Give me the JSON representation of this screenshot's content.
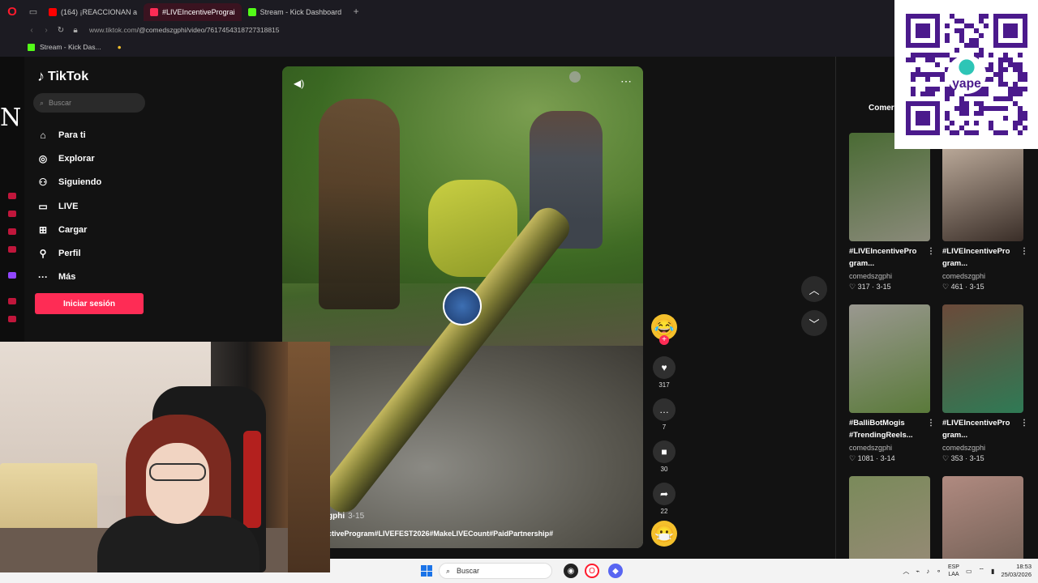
{
  "browser": {
    "tabs": [
      {
        "label": "(164) ¡REACCIONAN a",
        "color": "#ff0000"
      },
      {
        "label": "#LIVEIncentivePrograi",
        "color": "#fe2c55",
        "active": true
      },
      {
        "label": "Stream - Kick Dashboard",
        "color": "#53fc18"
      }
    ],
    "url_host": "www.tiktok.com",
    "url_path": "/@comedszgphi/video/7617454318727318815",
    "bookmark": "Stream - Kick Das..."
  },
  "tiktok": {
    "logo": "TikTok",
    "search_placeholder": "Buscar",
    "nav": [
      {
        "label": "Para ti",
        "icon": "home-icon",
        "glyph": "⌂"
      },
      {
        "label": "Explorar",
        "icon": "compass-icon",
        "glyph": "◎"
      },
      {
        "label": "Siguiendo",
        "icon": "following-icon",
        "glyph": "⚇"
      },
      {
        "label": "LIVE",
        "icon": "live-icon",
        "glyph": "▭"
      },
      {
        "label": "Cargar",
        "icon": "upload-icon",
        "glyph": "⊞"
      },
      {
        "label": "Perfil",
        "icon": "profile-icon",
        "glyph": "⚲"
      },
      {
        "label": "Más",
        "icon": "more-icon",
        "glyph": "···"
      }
    ],
    "login_button": "Iniciar sesión",
    "side_letter": "N"
  },
  "video": {
    "author": "gphi",
    "date": "3-15",
    "hashtags": "ctiveProgram#LIVEFEST2026#MakeLIVECount#PaidPartnership#"
  },
  "actions": {
    "likes": "317",
    "comments": "7",
    "saves": "30",
    "shares": "22"
  },
  "right_panel": {
    "tab": "Comer",
    "cards": [
      {
        "title": "#LIVEIncentivePro gram...",
        "user": "comedszgphi",
        "likes": "317",
        "date": "3-15",
        "colors": [
          "#4a6b34",
          "#8a8a7a"
        ]
      },
      {
        "title": "#LIVEIncentivePro gram...",
        "user": "comedszgphi",
        "likes": "461",
        "date": "3-15",
        "colors": [
          "#c9b7a6",
          "#3a2e28"
        ]
      },
      {
        "title": "#BalliBotMogis #TrendingReels...",
        "user": "comedszgphi",
        "likes": "1081",
        "date": "3-14",
        "colors": [
          "#9a9890",
          "#5a7a3a"
        ]
      },
      {
        "title": "#LIVEIncentivePro gram...",
        "user": "comedszgphi",
        "likes": "353",
        "date": "3-15",
        "colors": [
          "#6b4a3a",
          "#2f7a55"
        ]
      },
      {
        "title": "",
        "user": "",
        "likes": "",
        "date": "",
        "colors": [
          "#7a8a5a",
          "#9a8a7a"
        ]
      },
      {
        "title": "",
        "user": "",
        "likes": "",
        "date": "",
        "colors": [
          "#b08a80",
          "#6a5a50"
        ]
      }
    ]
  },
  "qr": {
    "brand": "yape"
  },
  "taskbar": {
    "search": "Buscar",
    "lang_top": "ESP",
    "lang_bottom": "LAA",
    "time": "18:53",
    "date": "25/03/2026"
  }
}
